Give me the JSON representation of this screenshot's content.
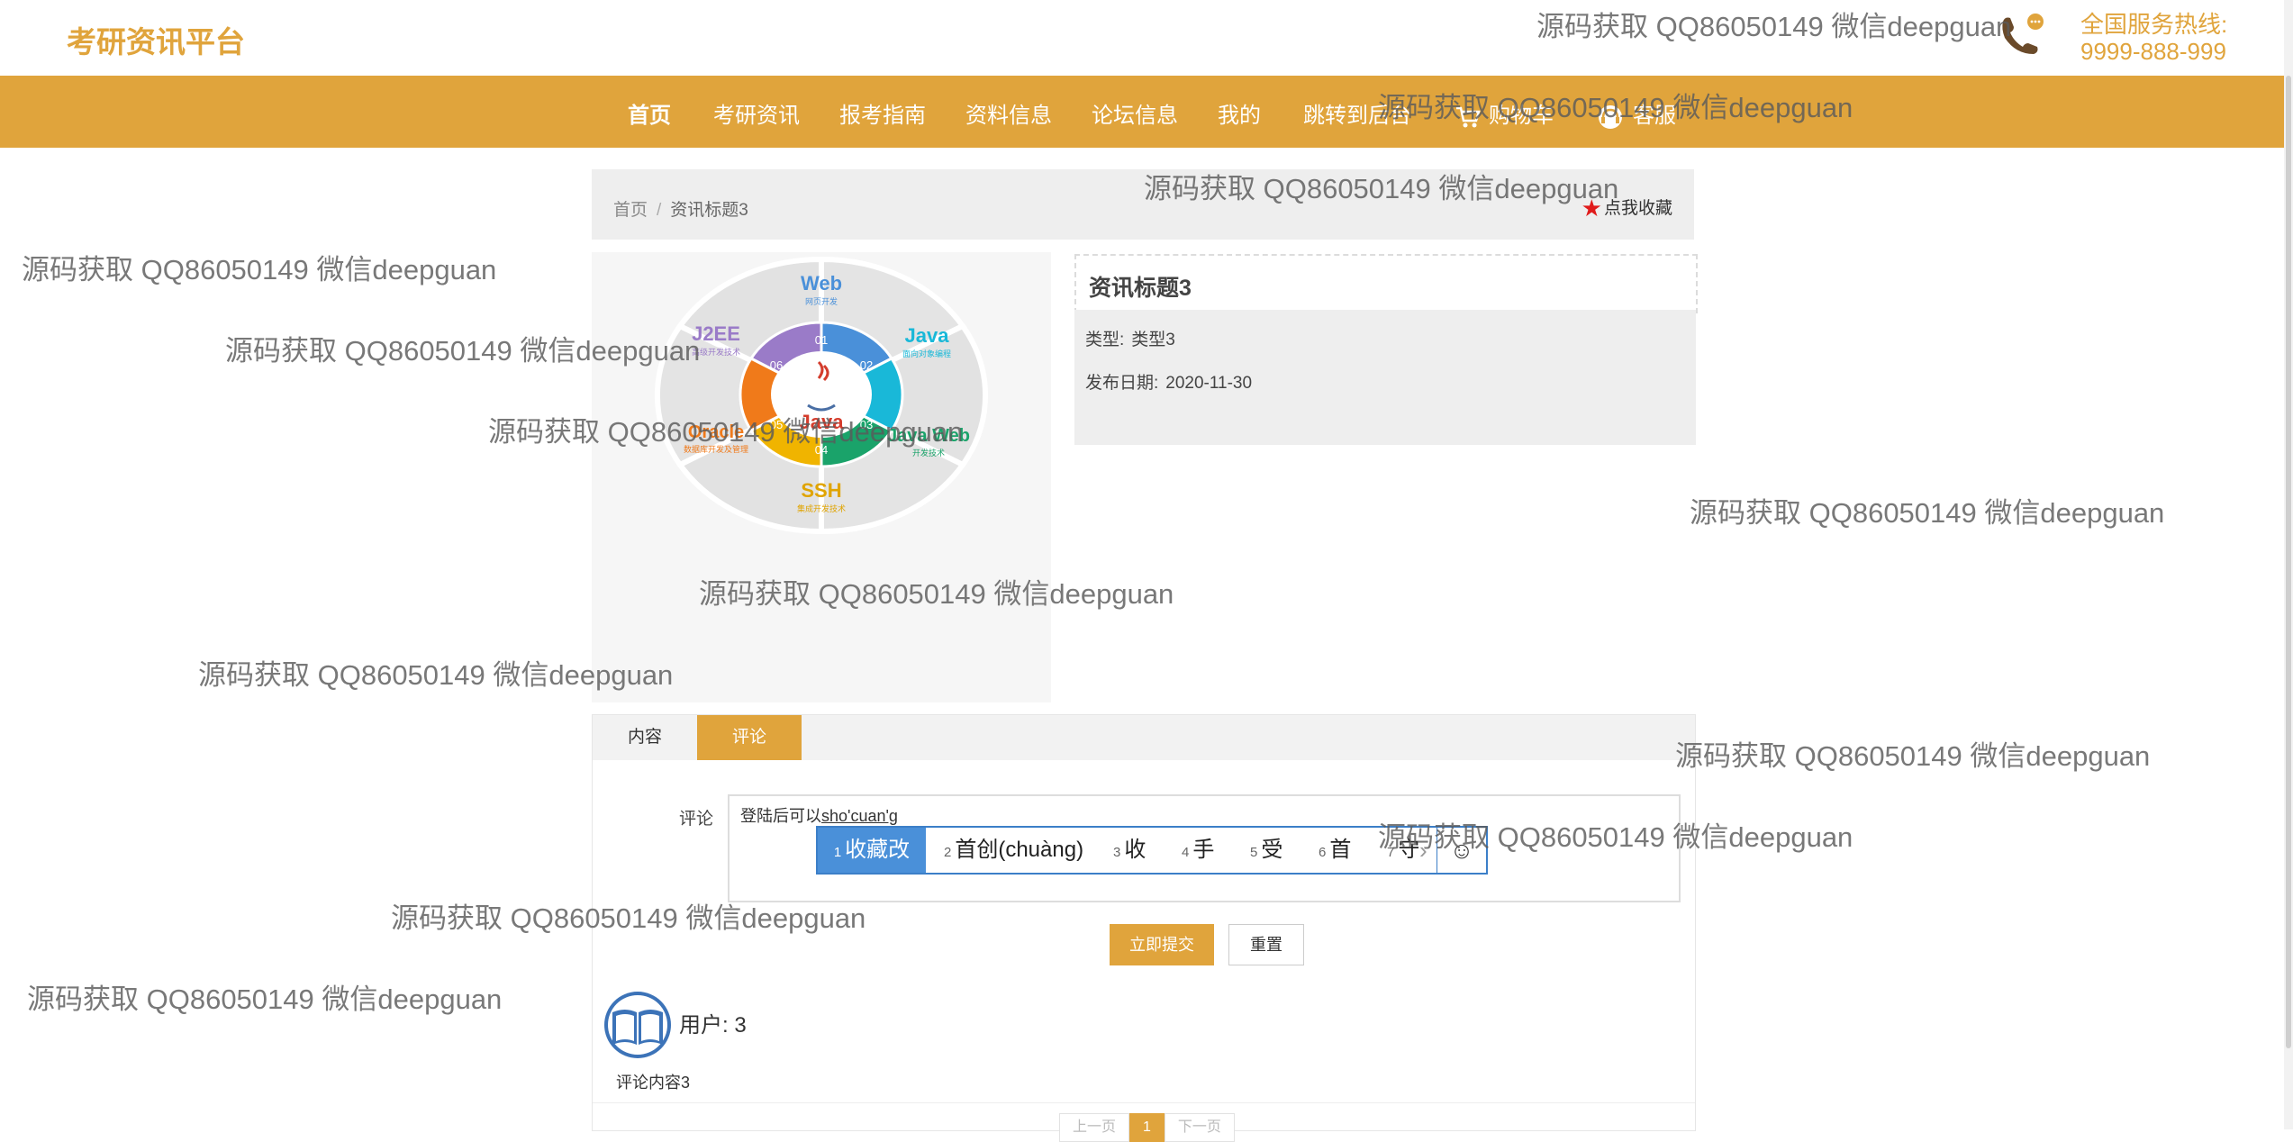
{
  "header": {
    "brand": "考研资讯平台",
    "hotline_label": "全国服务热线:",
    "hotline_number": "9999-888-999"
  },
  "nav": {
    "items": [
      "首页",
      "考研资讯",
      "报考指南",
      "资料信息",
      "论坛信息",
      "我的",
      "跳转到后台",
      "购物车",
      "客服"
    ]
  },
  "breadcrumb": {
    "home": "首页",
    "separator": "/",
    "current": "资讯标题3",
    "favorite": "点我收藏"
  },
  "image": {
    "center_label": "Java",
    "segments": [
      {
        "title": "Web",
        "sub": "网页开发",
        "num": "01"
      },
      {
        "title": "Java",
        "sub": "面向对象编程",
        "num": "02"
      },
      {
        "title": "Java Web",
        "sub": "开发技术",
        "num": "03"
      },
      {
        "title": "SSH",
        "sub": "集成开发技术",
        "num": "04"
      },
      {
        "title": "Oracle",
        "sub": "数据库开发及管理",
        "num": "05"
      },
      {
        "title": "J2EE",
        "sub": "高级开发技术",
        "num": "06"
      }
    ]
  },
  "info": {
    "title": "资讯标题3",
    "type_label": "类型:",
    "type_value": "类型3",
    "date_label": "发布日期:",
    "date_value": "2020-11-30"
  },
  "tabs": [
    "内容",
    "评论"
  ],
  "comment": {
    "label": "评论",
    "textarea_value": "登陆后可以",
    "textarea_typed": "sho'cuan'g",
    "submit": "立即提交",
    "reset": "重置",
    "user": "用户: 3",
    "content": "评论内容3"
  },
  "ime": {
    "candidates": [
      {
        "n": "1",
        "text": "收藏改"
      },
      {
        "n": "2",
        "text": "首创(chuàng)"
      },
      {
        "n": "3",
        "text": "收"
      },
      {
        "n": "4",
        "text": "手"
      },
      {
        "n": "5",
        "text": "受"
      },
      {
        "n": "6",
        "text": "首"
      },
      {
        "n": "7",
        "text": "守"
      }
    ],
    "emoji": "☺",
    "arrow": "›"
  },
  "pager": {
    "prev": "上一页",
    "current": "1",
    "next": "下一页"
  },
  "watermark": "源码获取 QQ86050149 微信deepguan"
}
